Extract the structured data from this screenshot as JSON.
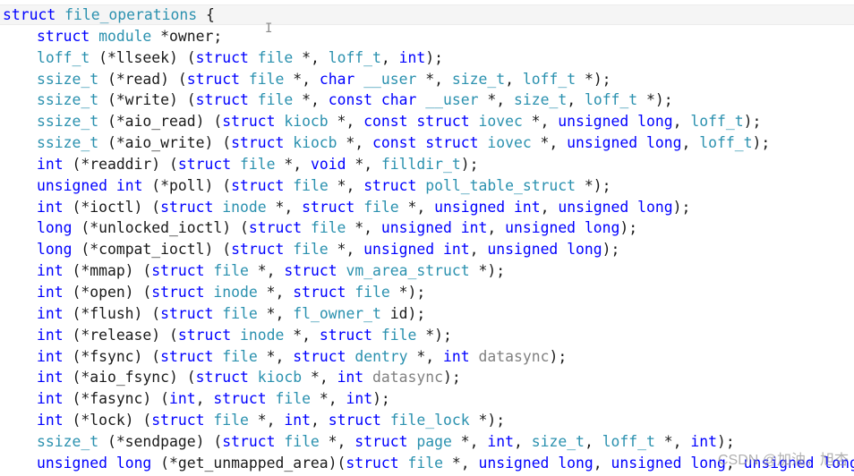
{
  "code": {
    "header": [
      {
        "t": "struct",
        "c": "kw"
      },
      {
        "t": " "
      },
      {
        "t": "file_operations",
        "c": "ty"
      },
      {
        "t": " {"
      }
    ],
    "lines": [
      [
        {
          "t": "struct",
          "c": "kw"
        },
        {
          "t": " "
        },
        {
          "t": "module",
          "c": "ty"
        },
        {
          "t": " *owner;"
        }
      ],
      [
        {
          "t": "loff_t",
          "c": "ty"
        },
        {
          "t": " (*llseek) ("
        },
        {
          "t": "struct",
          "c": "kw"
        },
        {
          "t": " "
        },
        {
          "t": "file",
          "c": "ty"
        },
        {
          "t": " *, "
        },
        {
          "t": "loff_t",
          "c": "ty"
        },
        {
          "t": ", "
        },
        {
          "t": "int",
          "c": "kw"
        },
        {
          "t": ");"
        }
      ],
      [
        {
          "t": "ssize_t",
          "c": "ty"
        },
        {
          "t": " (*read) ("
        },
        {
          "t": "struct",
          "c": "kw"
        },
        {
          "t": " "
        },
        {
          "t": "file",
          "c": "ty"
        },
        {
          "t": " *, "
        },
        {
          "t": "char",
          "c": "kw"
        },
        {
          "t": " "
        },
        {
          "t": "__user",
          "c": "ty"
        },
        {
          "t": " *, "
        },
        {
          "t": "size_t",
          "c": "ty"
        },
        {
          "t": ", "
        },
        {
          "t": "loff_t",
          "c": "ty"
        },
        {
          "t": " *);"
        }
      ],
      [
        {
          "t": "ssize_t",
          "c": "ty"
        },
        {
          "t": " (*write) ("
        },
        {
          "t": "struct",
          "c": "kw"
        },
        {
          "t": " "
        },
        {
          "t": "file",
          "c": "ty"
        },
        {
          "t": " *, "
        },
        {
          "t": "const",
          "c": "kw"
        },
        {
          "t": " "
        },
        {
          "t": "char",
          "c": "kw"
        },
        {
          "t": " "
        },
        {
          "t": "__user",
          "c": "ty"
        },
        {
          "t": " *, "
        },
        {
          "t": "size_t",
          "c": "ty"
        },
        {
          "t": ", "
        },
        {
          "t": "loff_t",
          "c": "ty"
        },
        {
          "t": " *);"
        }
      ],
      [
        {
          "t": "ssize_t",
          "c": "ty"
        },
        {
          "t": " (*aio_read) ("
        },
        {
          "t": "struct",
          "c": "kw"
        },
        {
          "t": " "
        },
        {
          "t": "kiocb",
          "c": "ty"
        },
        {
          "t": " *, "
        },
        {
          "t": "const",
          "c": "kw"
        },
        {
          "t": " "
        },
        {
          "t": "struct",
          "c": "kw"
        },
        {
          "t": " "
        },
        {
          "t": "iovec",
          "c": "ty"
        },
        {
          "t": " *, "
        },
        {
          "t": "unsigned",
          "c": "kw"
        },
        {
          "t": " "
        },
        {
          "t": "long",
          "c": "kw"
        },
        {
          "t": ", "
        },
        {
          "t": "loff_t",
          "c": "ty"
        },
        {
          "t": ");"
        }
      ],
      [
        {
          "t": "ssize_t",
          "c": "ty"
        },
        {
          "t": " (*aio_write) ("
        },
        {
          "t": "struct",
          "c": "kw"
        },
        {
          "t": " "
        },
        {
          "t": "kiocb",
          "c": "ty"
        },
        {
          "t": " *, "
        },
        {
          "t": "const",
          "c": "kw"
        },
        {
          "t": " "
        },
        {
          "t": "struct",
          "c": "kw"
        },
        {
          "t": " "
        },
        {
          "t": "iovec",
          "c": "ty"
        },
        {
          "t": " *, "
        },
        {
          "t": "unsigned",
          "c": "kw"
        },
        {
          "t": " "
        },
        {
          "t": "long",
          "c": "kw"
        },
        {
          "t": ", "
        },
        {
          "t": "loff_t",
          "c": "ty"
        },
        {
          "t": ");"
        }
      ],
      [
        {
          "t": "int",
          "c": "kw"
        },
        {
          "t": " (*readdir) ("
        },
        {
          "t": "struct",
          "c": "kw"
        },
        {
          "t": " "
        },
        {
          "t": "file",
          "c": "ty"
        },
        {
          "t": " *, "
        },
        {
          "t": "void",
          "c": "kw"
        },
        {
          "t": " *, "
        },
        {
          "t": "filldir_t",
          "c": "ty"
        },
        {
          "t": ");"
        }
      ],
      [
        {
          "t": "unsigned",
          "c": "kw"
        },
        {
          "t": " "
        },
        {
          "t": "int",
          "c": "kw"
        },
        {
          "t": " (*poll) ("
        },
        {
          "t": "struct",
          "c": "kw"
        },
        {
          "t": " "
        },
        {
          "t": "file",
          "c": "ty"
        },
        {
          "t": " *, "
        },
        {
          "t": "struct",
          "c": "kw"
        },
        {
          "t": " "
        },
        {
          "t": "poll_table_struct",
          "c": "ty"
        },
        {
          "t": " *);"
        }
      ],
      [
        {
          "t": "int",
          "c": "kw"
        },
        {
          "t": " (*ioctl) ("
        },
        {
          "t": "struct",
          "c": "kw"
        },
        {
          "t": " "
        },
        {
          "t": "inode",
          "c": "ty"
        },
        {
          "t": " *, "
        },
        {
          "t": "struct",
          "c": "kw"
        },
        {
          "t": " "
        },
        {
          "t": "file",
          "c": "ty"
        },
        {
          "t": " *, "
        },
        {
          "t": "unsigned",
          "c": "kw"
        },
        {
          "t": " "
        },
        {
          "t": "int",
          "c": "kw"
        },
        {
          "t": ", "
        },
        {
          "t": "unsigned",
          "c": "kw"
        },
        {
          "t": " "
        },
        {
          "t": "long",
          "c": "kw"
        },
        {
          "t": ");"
        }
      ],
      [
        {
          "t": "long",
          "c": "kw"
        },
        {
          "t": " (*unlocked_ioctl) ("
        },
        {
          "t": "struct",
          "c": "kw"
        },
        {
          "t": " "
        },
        {
          "t": "file",
          "c": "ty"
        },
        {
          "t": " *, "
        },
        {
          "t": "unsigned",
          "c": "kw"
        },
        {
          "t": " "
        },
        {
          "t": "int",
          "c": "kw"
        },
        {
          "t": ", "
        },
        {
          "t": "unsigned",
          "c": "kw"
        },
        {
          "t": " "
        },
        {
          "t": "long",
          "c": "kw"
        },
        {
          "t": ");"
        }
      ],
      [
        {
          "t": "long",
          "c": "kw"
        },
        {
          "t": " (*compat_ioctl) ("
        },
        {
          "t": "struct",
          "c": "kw"
        },
        {
          "t": " "
        },
        {
          "t": "file",
          "c": "ty"
        },
        {
          "t": " *, "
        },
        {
          "t": "unsigned",
          "c": "kw"
        },
        {
          "t": " "
        },
        {
          "t": "int",
          "c": "kw"
        },
        {
          "t": ", "
        },
        {
          "t": "unsigned",
          "c": "kw"
        },
        {
          "t": " "
        },
        {
          "t": "long",
          "c": "kw"
        },
        {
          "t": ");"
        }
      ],
      [
        {
          "t": "int",
          "c": "kw"
        },
        {
          "t": " (*mmap) ("
        },
        {
          "t": "struct",
          "c": "kw"
        },
        {
          "t": " "
        },
        {
          "t": "file",
          "c": "ty"
        },
        {
          "t": " *, "
        },
        {
          "t": "struct",
          "c": "kw"
        },
        {
          "t": " "
        },
        {
          "t": "vm_area_struct",
          "c": "ty"
        },
        {
          "t": " *);"
        }
      ],
      [
        {
          "t": "int",
          "c": "kw"
        },
        {
          "t": " (*open) ("
        },
        {
          "t": "struct",
          "c": "kw"
        },
        {
          "t": " "
        },
        {
          "t": "inode",
          "c": "ty"
        },
        {
          "t": " *, "
        },
        {
          "t": "struct",
          "c": "kw"
        },
        {
          "t": " "
        },
        {
          "t": "file",
          "c": "ty"
        },
        {
          "t": " *);"
        }
      ],
      [
        {
          "t": "int",
          "c": "kw"
        },
        {
          "t": " (*flush) ("
        },
        {
          "t": "struct",
          "c": "kw"
        },
        {
          "t": " "
        },
        {
          "t": "file",
          "c": "ty"
        },
        {
          "t": " *, "
        },
        {
          "t": "fl_owner_t",
          "c": "ty"
        },
        {
          "t": " id);"
        }
      ],
      [
        {
          "t": "int",
          "c": "kw"
        },
        {
          "t": " (*release) ("
        },
        {
          "t": "struct",
          "c": "kw"
        },
        {
          "t": " "
        },
        {
          "t": "inode",
          "c": "ty"
        },
        {
          "t": " *, "
        },
        {
          "t": "struct",
          "c": "kw"
        },
        {
          "t": " "
        },
        {
          "t": "file",
          "c": "ty"
        },
        {
          "t": " *);"
        }
      ],
      [
        {
          "t": "int",
          "c": "kw"
        },
        {
          "t": " (*fsync) ("
        },
        {
          "t": "struct",
          "c": "kw"
        },
        {
          "t": " "
        },
        {
          "t": "file",
          "c": "ty"
        },
        {
          "t": " *, "
        },
        {
          "t": "struct",
          "c": "kw"
        },
        {
          "t": " "
        },
        {
          "t": "dentry",
          "c": "ty"
        },
        {
          "t": " *, "
        },
        {
          "t": "int",
          "c": "kw"
        },
        {
          "t": " "
        },
        {
          "t": "datasync",
          "c": "pm"
        },
        {
          "t": ");"
        }
      ],
      [
        {
          "t": "int",
          "c": "kw"
        },
        {
          "t": " (*aio_fsync) ("
        },
        {
          "t": "struct",
          "c": "kw"
        },
        {
          "t": " "
        },
        {
          "t": "kiocb",
          "c": "ty"
        },
        {
          "t": " *, "
        },
        {
          "t": "int",
          "c": "kw"
        },
        {
          "t": " "
        },
        {
          "t": "datasync",
          "c": "pm"
        },
        {
          "t": ");"
        }
      ],
      [
        {
          "t": "int",
          "c": "kw"
        },
        {
          "t": " (*fasync) ("
        },
        {
          "t": "int",
          "c": "kw"
        },
        {
          "t": ", "
        },
        {
          "t": "struct",
          "c": "kw"
        },
        {
          "t": " "
        },
        {
          "t": "file",
          "c": "ty"
        },
        {
          "t": " *, "
        },
        {
          "t": "int",
          "c": "kw"
        },
        {
          "t": ");"
        }
      ],
      [
        {
          "t": "int",
          "c": "kw"
        },
        {
          "t": " (*lock) ("
        },
        {
          "t": "struct",
          "c": "kw"
        },
        {
          "t": " "
        },
        {
          "t": "file",
          "c": "ty"
        },
        {
          "t": " *, "
        },
        {
          "t": "int",
          "c": "kw"
        },
        {
          "t": ", "
        },
        {
          "t": "struct",
          "c": "kw"
        },
        {
          "t": " "
        },
        {
          "t": "file_lock",
          "c": "ty"
        },
        {
          "t": " *);"
        }
      ],
      [
        {
          "t": "ssize_t",
          "c": "ty"
        },
        {
          "t": " (*sendpage) ("
        },
        {
          "t": "struct",
          "c": "kw"
        },
        {
          "t": " "
        },
        {
          "t": "file",
          "c": "ty"
        },
        {
          "t": " *, "
        },
        {
          "t": "struct",
          "c": "kw"
        },
        {
          "t": " "
        },
        {
          "t": "page",
          "c": "ty"
        },
        {
          "t": " *, "
        },
        {
          "t": "int",
          "c": "kw"
        },
        {
          "t": ", "
        },
        {
          "t": "size_t",
          "c": "ty"
        },
        {
          "t": ", "
        },
        {
          "t": "loff_t",
          "c": "ty"
        },
        {
          "t": " *, "
        },
        {
          "t": "int",
          "c": "kw"
        },
        {
          "t": ");"
        }
      ],
      [
        {
          "t": "unsigned",
          "c": "kw"
        },
        {
          "t": " "
        },
        {
          "t": "long",
          "c": "kw"
        },
        {
          "t": " (*get_unmapped_area)("
        },
        {
          "t": "struct",
          "c": "kw"
        },
        {
          "t": " "
        },
        {
          "t": "file",
          "c": "ty"
        },
        {
          "t": " *, "
        },
        {
          "t": "unsigned",
          "c": "kw"
        },
        {
          "t": " "
        },
        {
          "t": "long",
          "c": "kw"
        },
        {
          "t": ", "
        },
        {
          "t": "unsigned",
          "c": "kw"
        },
        {
          "t": " "
        },
        {
          "t": "long",
          "c": "kw"
        },
        {
          "t": ", "
        },
        {
          "t": "unsigned",
          "c": "kw"
        },
        {
          "t": " "
        },
        {
          "t": "long",
          "c": "kw"
        },
        {
          "t": ","
        }
      ]
    ]
  },
  "cursor_glyph": "I",
  "watermark": "CSDN @加油，旭杏",
  "colors": {
    "keyword": "#0000ff",
    "type": "#2b91af",
    "identifier": "#1a1a1a",
    "parameter": "#808080",
    "current_line": "#f5f5f5"
  }
}
